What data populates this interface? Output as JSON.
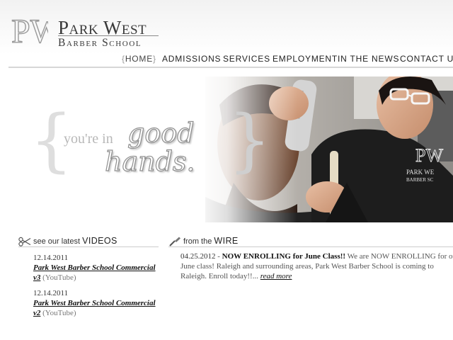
{
  "logo": {
    "title": "Park West",
    "subtitle": "Barber School",
    "mark_letters": "PW"
  },
  "nav": {
    "brace_open": "{",
    "brace_close": "}",
    "items": [
      {
        "label": "HOME",
        "active": true
      },
      {
        "label": "ADMISSIONS"
      },
      {
        "label": "SERVICES"
      },
      {
        "label": "EMPLOYMENT"
      },
      {
        "label": "IN THE NEWS"
      },
      {
        "label": "CONTACT US"
      }
    ]
  },
  "hero": {
    "tag_small": "you're in",
    "tag_big_1": "good",
    "tag_big_2": "hands.",
    "brace_open": "{",
    "brace_close": "}",
    "jacket_logo_letters": "PW",
    "jacket_text_1": "PARK WE",
    "jacket_text_2": "BARBER SC"
  },
  "videos": {
    "heading_prefix": "see our latest",
    "heading_main": "VIDEOS",
    "items": [
      {
        "date": "12.14.2011",
        "title": "Park West Barber School Commercial v3",
        "source": "(YouTube)"
      },
      {
        "date": "12.14.2011",
        "title": "Park West Barber School Commercial v2",
        "source": "(YouTube)"
      }
    ]
  },
  "wire": {
    "heading_prefix": "from the",
    "heading_main": "WIRE",
    "date": "04.25.2012",
    "separator": " - ",
    "title": "NOW ENROLLING for June Class!!",
    "body": " We are NOW ENROLLING for our June class! Raleigh and surrounding areas, Park West Barber School is coming to Raleigh. Enroll today!!... ",
    "more": "read more"
  },
  "colors": {
    "text": "#333333",
    "link": "#111111",
    "rule": "#cccccc",
    "tagline": "#b8b8b8"
  }
}
